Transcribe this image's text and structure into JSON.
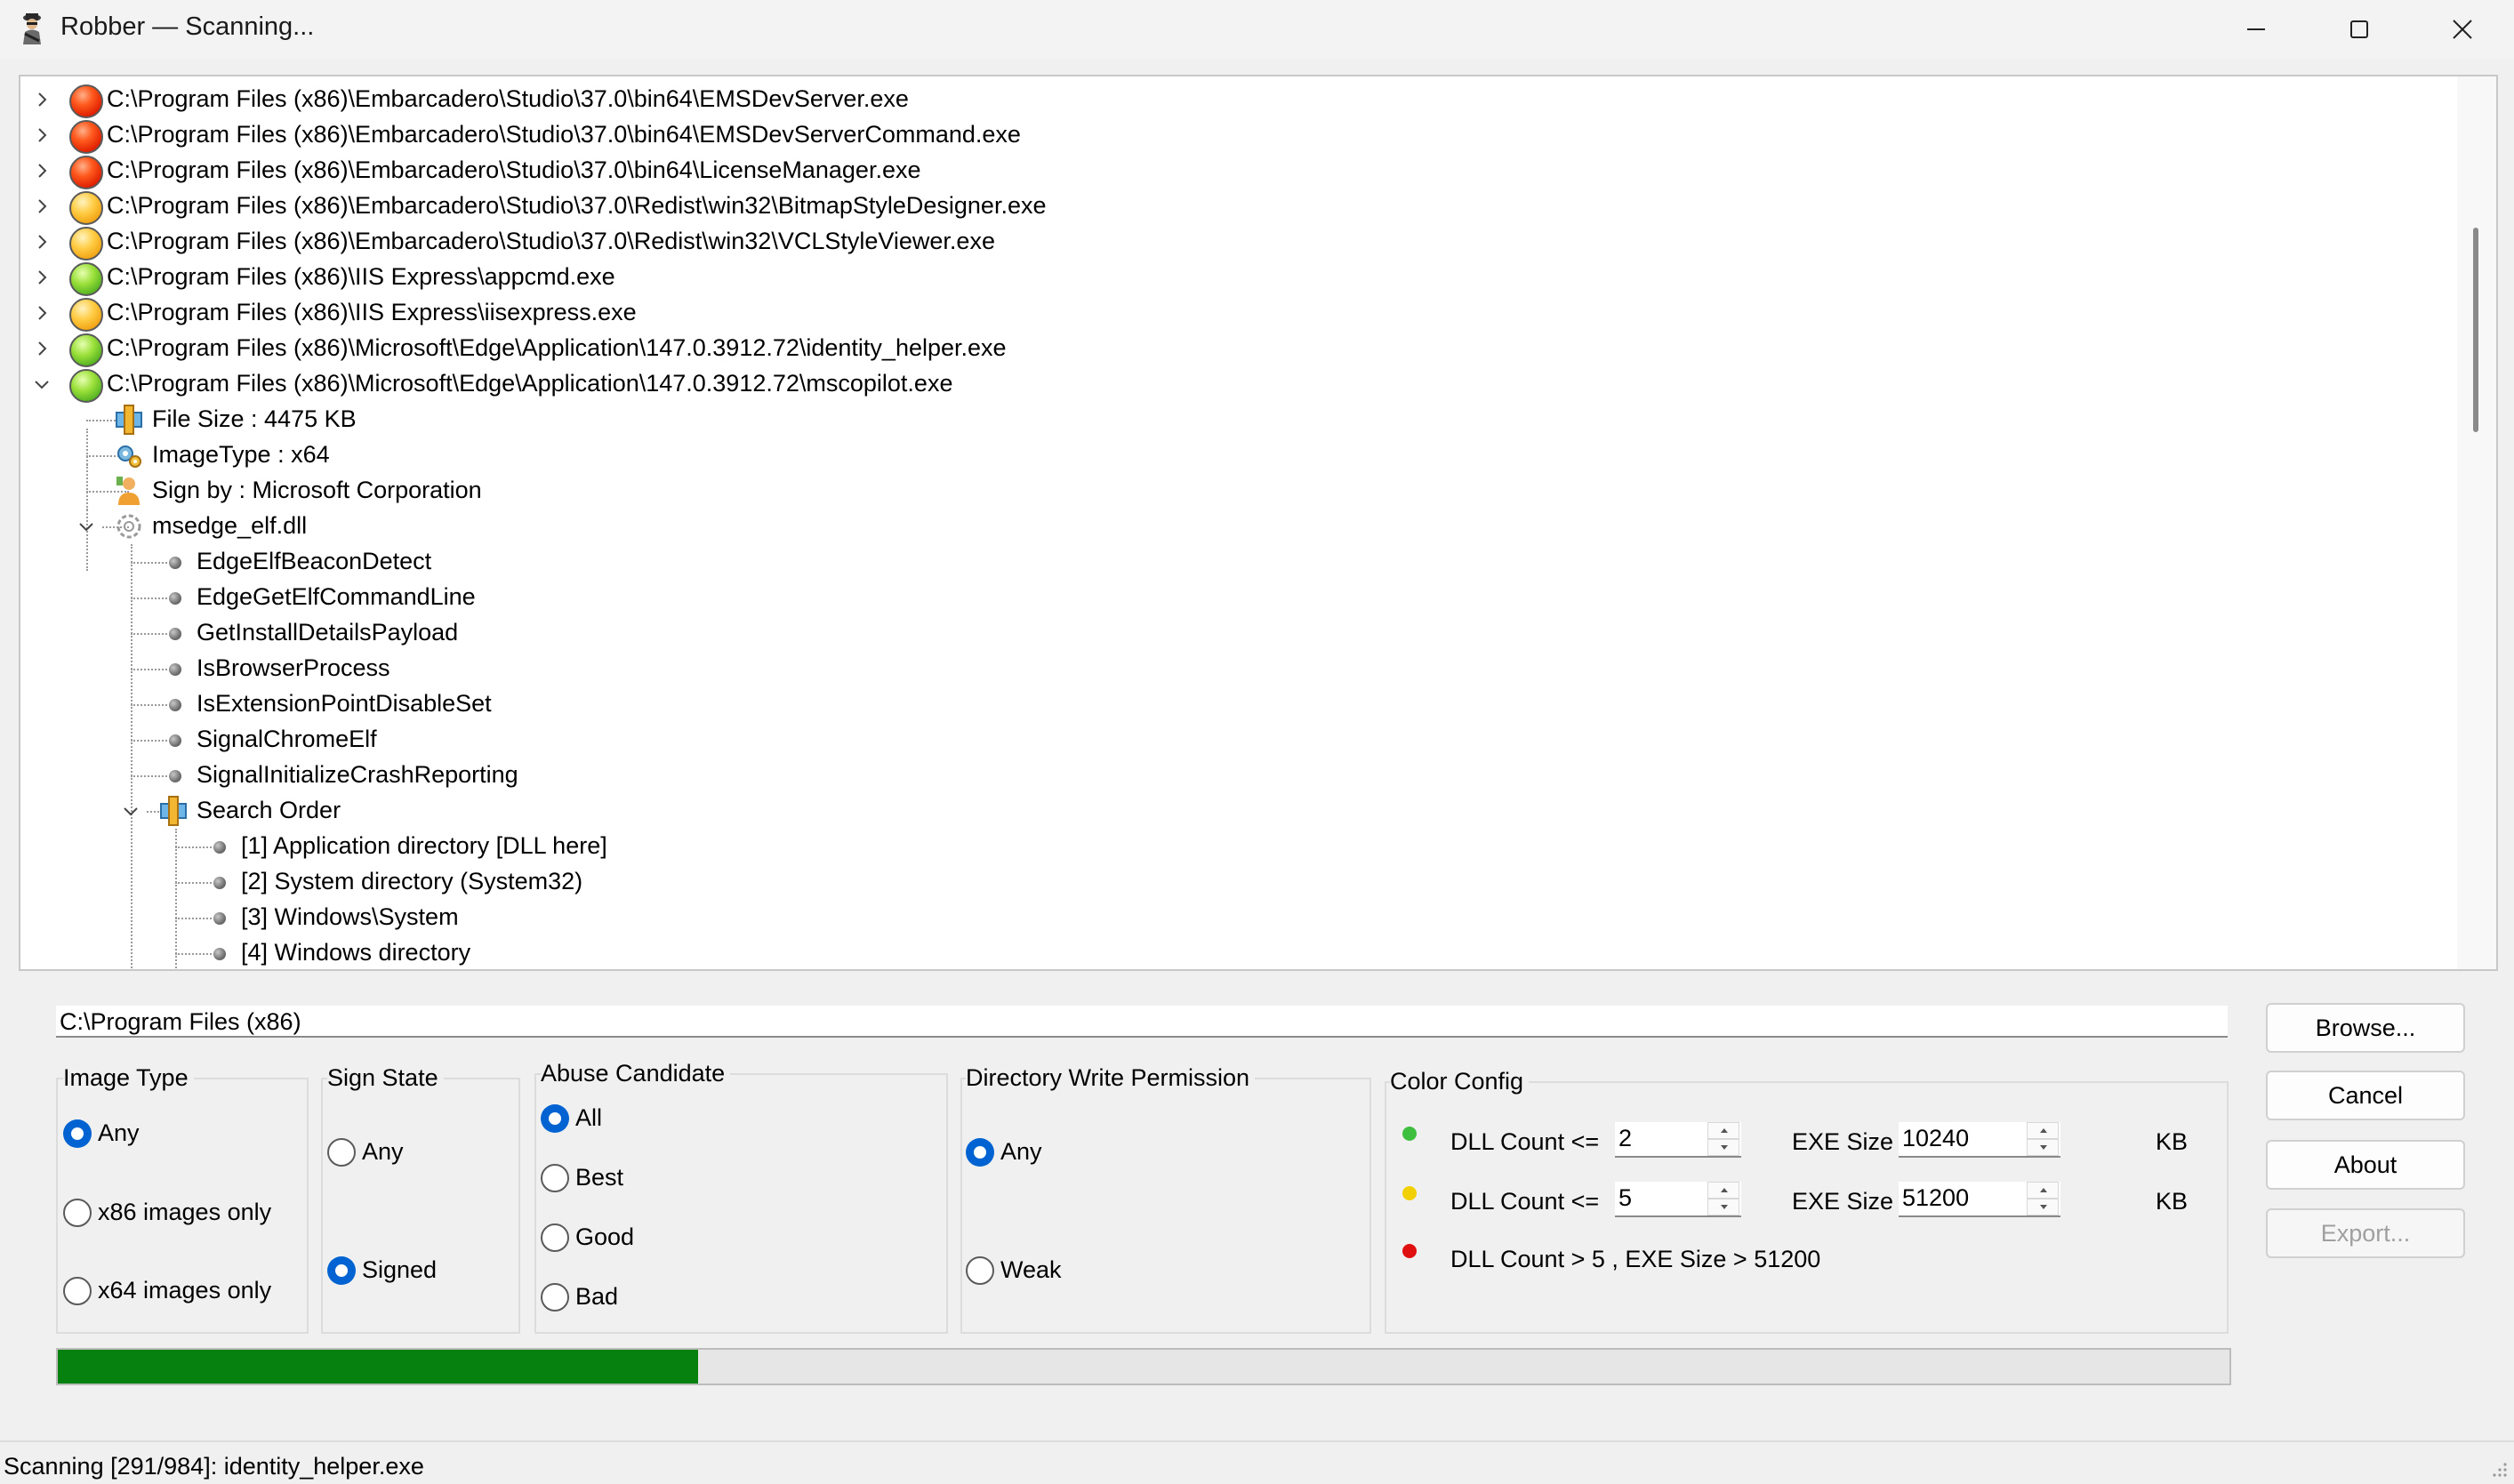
{
  "window": {
    "title": "Robber — Scanning..."
  },
  "tree": {
    "executables": [
      {
        "path": "C:\\Program Files (x86)\\Embarcadero\\Studio\\37.0\\bin64\\EMSDevServer.exe",
        "status": "red"
      },
      {
        "path": "C:\\Program Files (x86)\\Embarcadero\\Studio\\37.0\\bin64\\EMSDevServerCommand.exe",
        "status": "red"
      },
      {
        "path": "C:\\Program Files (x86)\\Embarcadero\\Studio\\37.0\\bin64\\LicenseManager.exe",
        "status": "red"
      },
      {
        "path": "C:\\Program Files (x86)\\Embarcadero\\Studio\\37.0\\Redist\\win32\\BitmapStyleDesigner.exe",
        "status": "orange"
      },
      {
        "path": "C:\\Program Files (x86)\\Embarcadero\\Studio\\37.0\\Redist\\win32\\VCLStyleViewer.exe",
        "status": "orange"
      },
      {
        "path": "C:\\Program Files (x86)\\IIS Express\\appcmd.exe",
        "status": "green"
      },
      {
        "path": "C:\\Program Files (x86)\\IIS Express\\iisexpress.exe",
        "status": "orange"
      },
      {
        "path": "C:\\Program Files (x86)\\Microsoft\\Edge\\Application\\147.0.3912.72\\identity_helper.exe",
        "status": "green"
      },
      {
        "path": "C:\\Program Files (x86)\\Microsoft\\Edge\\Application\\147.0.3912.72\\mscopilot.exe",
        "status": "green"
      }
    ],
    "details": {
      "file_size": "File Size : 4475 KB",
      "image_type": "ImageType : x64",
      "sign_by": "Sign by : Microsoft Corporation",
      "dll_name": "msedge_elf.dll",
      "exports": [
        "EdgeElfBeaconDetect",
        "EdgeGetElfCommandLine",
        "GetInstallDetailsPayload",
        "IsBrowserProcess",
        "IsExtensionPointDisableSet",
        "SignalChromeElf",
        "SignalInitializeCrashReporting"
      ],
      "search_order_label": "Search Order",
      "search_order": [
        "[1] Application directory [DLL here]",
        "[2] System directory (System32)",
        "[3] Windows\\System",
        "[4] Windows directory"
      ]
    }
  },
  "path_input": {
    "value": "C:\\Program Files (x86)"
  },
  "buttons": {
    "browse": "Browse...",
    "cancel": "Cancel",
    "about": "About",
    "export": "Export..."
  },
  "image_type": {
    "title": "Image Type",
    "options": [
      "Any",
      "x86 images only",
      "x64 images only"
    ],
    "selected": "Any"
  },
  "sign_state": {
    "title": "Sign State",
    "options": [
      "Any",
      "Signed"
    ],
    "selected": "Signed"
  },
  "abuse_candidate": {
    "title": "Abuse Candidate",
    "options": [
      "All",
      "Best",
      "Good",
      "Bad"
    ],
    "selected": "All"
  },
  "dir_write": {
    "title": "Directory Write Permission",
    "options": [
      "Any",
      "Weak"
    ],
    "selected": "Any"
  },
  "color_config": {
    "title": "Color Config",
    "green_label": "DLL Count <=",
    "green_dll": "2",
    "green_exe_label": "EXE Size",
    "green_exe": "10240",
    "yellow_label": "DLL Count <=",
    "yellow_dll": "5",
    "yellow_exe_label": "EXE Size",
    "yellow_exe": "51200",
    "kb_unit": "KB",
    "red_label": "DLL Count > 5 , EXE Size > 51200",
    "colors": {
      "green": "#3fbf3f",
      "yellow": "#f2d000",
      "red": "#e01010"
    }
  },
  "progress": {
    "fraction": 0.295
  },
  "status": {
    "text": "Scanning [291/984]: identity_helper.exe"
  }
}
